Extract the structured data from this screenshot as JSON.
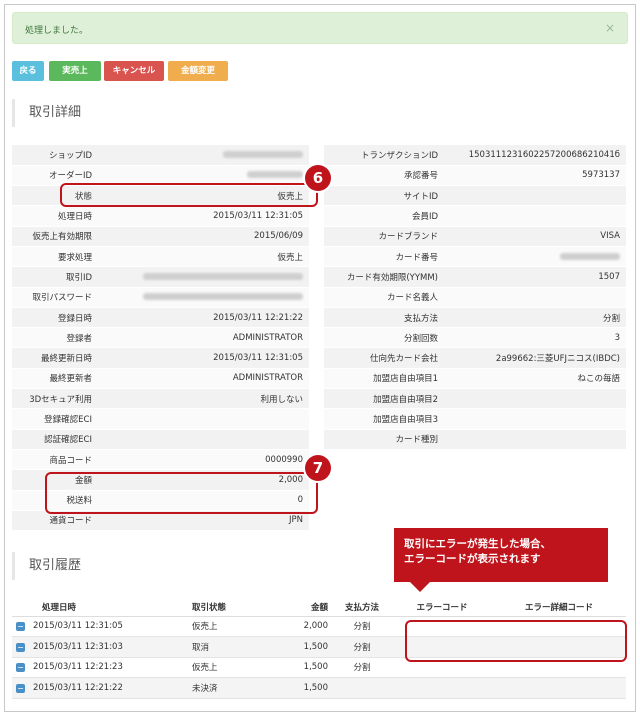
{
  "alert": {
    "message": "処理しました。",
    "close": "×"
  },
  "buttons": {
    "back": "戻る",
    "sale": "実売上",
    "cancel": "キャンセル",
    "amount_change": "金額変更"
  },
  "detail": {
    "title": "取引詳細",
    "left": [
      {
        "key": "ショップID",
        "value": "",
        "redacted": true
      },
      {
        "key": "オーダーID",
        "value": "",
        "redacted": true
      },
      {
        "key": "状態",
        "value": "仮売上"
      },
      {
        "key": "処理日時",
        "value": "2015/03/11 12:31:05"
      },
      {
        "key": "仮売上有効期限",
        "value": "2015/06/09"
      },
      {
        "key": "要求処理",
        "value": "仮売上"
      },
      {
        "key": "取引ID",
        "value": "",
        "redacted": true
      },
      {
        "key": "取引パスワード",
        "value": "",
        "redacted": true
      },
      {
        "key": "登録日時",
        "value": "2015/03/11 12:21:22"
      },
      {
        "key": "登録者",
        "value": "ADMINISTRATOR"
      },
      {
        "key": "最終更新日時",
        "value": "2015/03/11 12:31:05"
      },
      {
        "key": "最終更新者",
        "value": "ADMINISTRATOR"
      },
      {
        "key": "3Dセキュア利用",
        "value": "利用しない"
      },
      {
        "key": "登録確認ECI",
        "value": ""
      },
      {
        "key": "認証確認ECI",
        "value": ""
      },
      {
        "key": "商品コード",
        "value": "0000990"
      },
      {
        "key": "金額",
        "value": "2,000"
      },
      {
        "key": "税送料",
        "value": "0"
      },
      {
        "key": "通貨コード",
        "value": "JPN"
      }
    ],
    "right": [
      {
        "key": "トランザクションID",
        "value": "150311123160225720068621041б"
      },
      {
        "key": "承認番号",
        "value": "5973137"
      },
      {
        "key": "サイトID",
        "value": ""
      },
      {
        "key": "会員ID",
        "value": ""
      },
      {
        "key": "カードブランド",
        "value": "VISA"
      },
      {
        "key": "カード番号",
        "value": "",
        "redacted": true
      },
      {
        "key": "カード有効期限(YYMM)",
        "value": "1507"
      },
      {
        "key": "カード名義人",
        "value": ""
      },
      {
        "key": "支払方法",
        "value": "分割"
      },
      {
        "key": "分割回数",
        "value": "3"
      },
      {
        "key": "仕向先カード会社",
        "value": "2a99662:三菱UFJニコス(IBDC)"
      },
      {
        "key": "加盟店自由項目1",
        "value": "ねこの毎語"
      },
      {
        "key": "加盟店自由項目2",
        "value": ""
      },
      {
        "key": "加盟店自由項目3",
        "value": ""
      },
      {
        "key": "カード種別",
        "value": ""
      }
    ]
  },
  "annotations": {
    "badge6": "6",
    "badge7": "7",
    "callout_line1": "取引にエラーが発生した場合、",
    "callout_line2": "エラーコードが表示されます"
  },
  "history": {
    "title": "取引履歴",
    "columns": [
      "処理日時",
      "取引状態",
      "金額",
      "支払方法",
      "エラーコード",
      "エラー詳細コード"
    ],
    "rows": [
      {
        "date": "2015/03/11 12:31:05",
        "status": "仮売上",
        "amount": "2,000",
        "method": "分割",
        "error": "",
        "error_detail": ""
      },
      {
        "date": "2015/03/11 12:31:03",
        "status": "取消",
        "amount": "1,500",
        "method": "分割",
        "error": "",
        "error_detail": ""
      },
      {
        "date": "2015/03/11 12:21:23",
        "status": "仮売上",
        "amount": "1,500",
        "method": "分割",
        "error": "",
        "error_detail": ""
      },
      {
        "date": "2015/03/11 12:21:22",
        "status": "未決済",
        "amount": "1,500",
        "method": "",
        "error": "",
        "error_detail": ""
      }
    ]
  }
}
